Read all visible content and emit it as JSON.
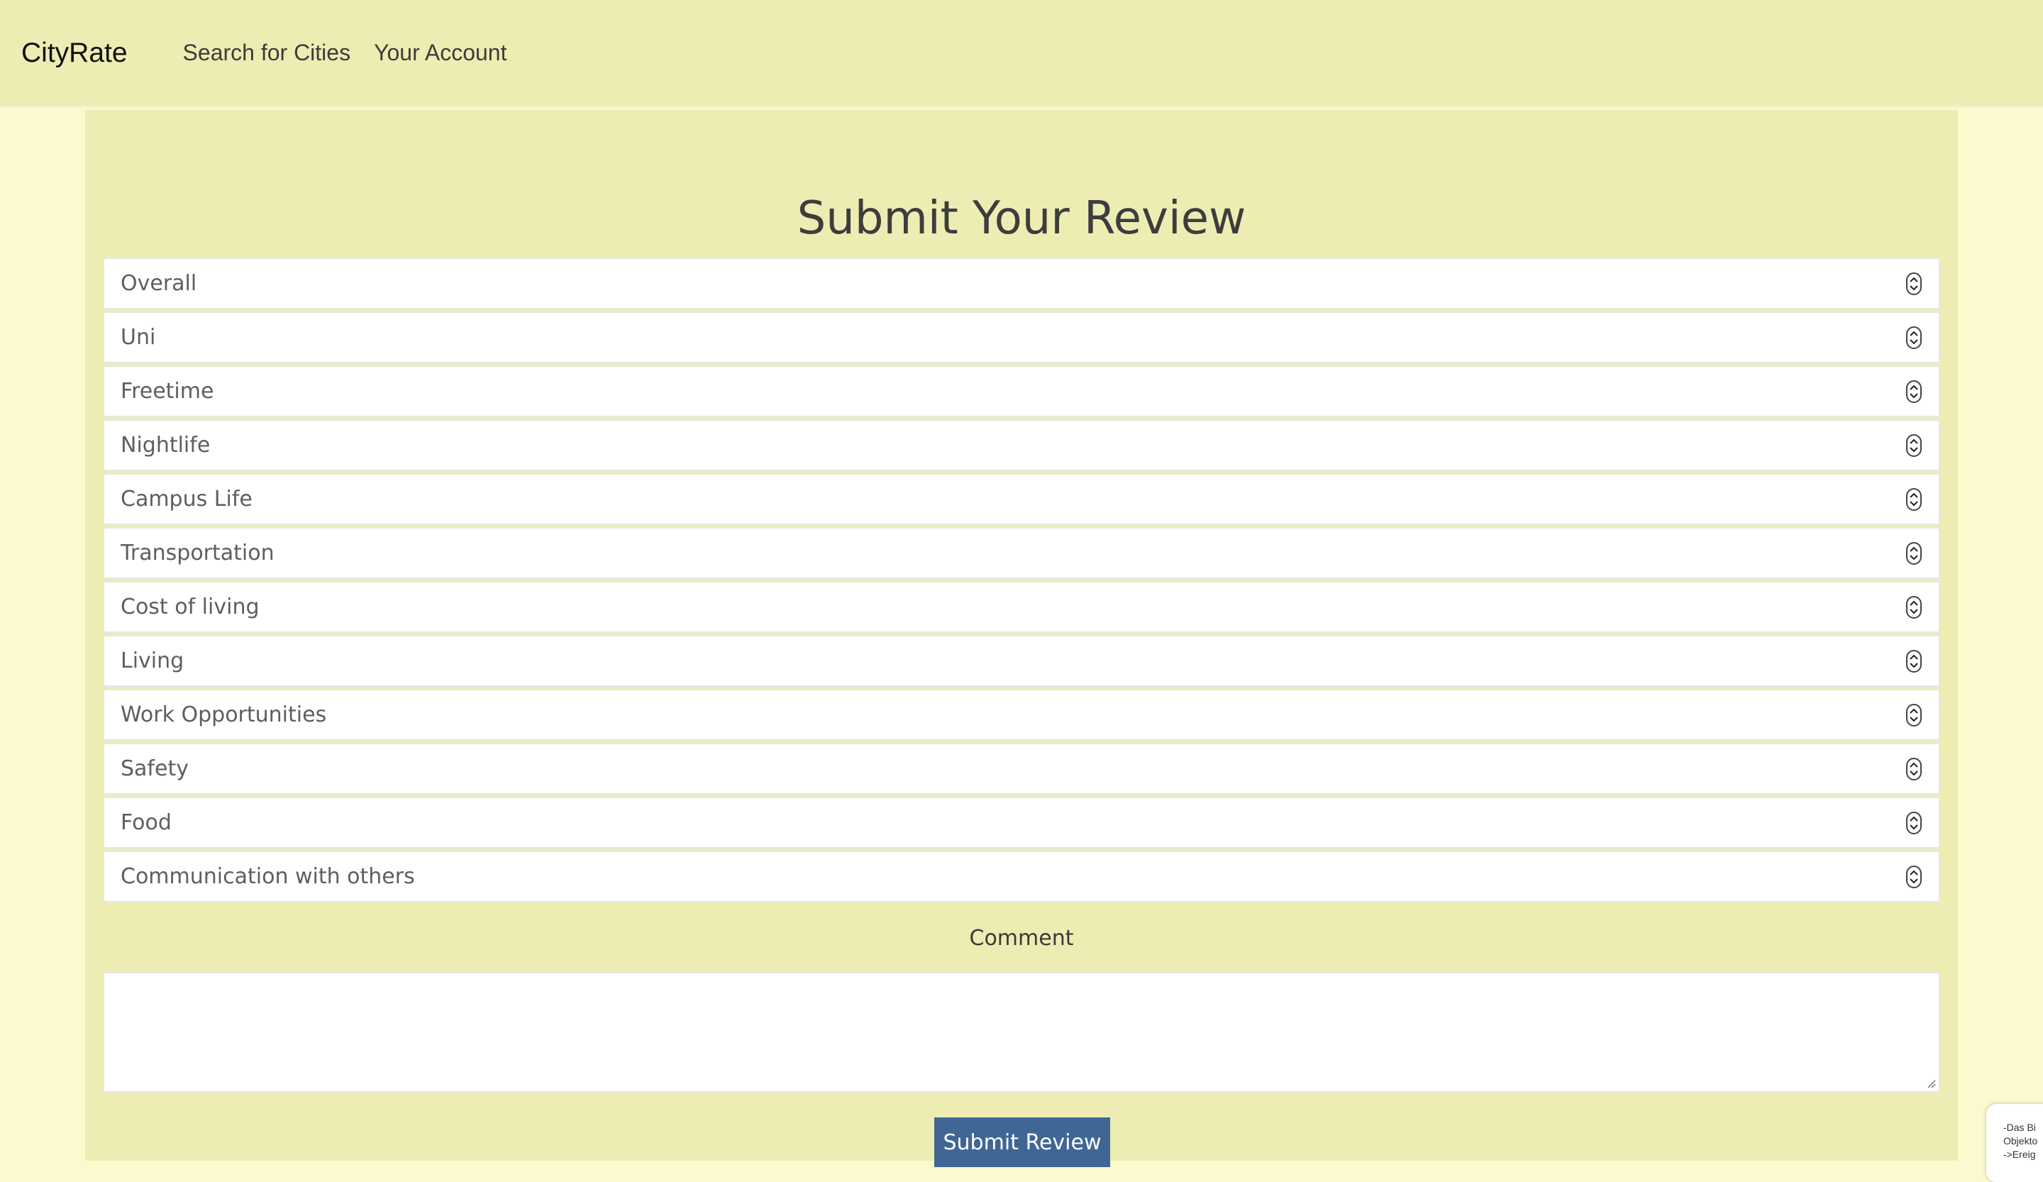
{
  "nav": {
    "brand": "CityRate",
    "links": [
      "Search for Cities",
      "Your Account"
    ]
  },
  "page": {
    "title": "Submit Your Review",
    "categories": [
      "Overall",
      "Uni",
      "Freetime",
      "Nightlife",
      "Campus Life",
      "Transportation",
      "Cost of living",
      "Living",
      "Work Opportunities",
      "Safety",
      "Food",
      "Communication with others"
    ],
    "comment_label": "Comment",
    "comment_value": "",
    "submit_label": "Submit Review"
  },
  "side_note": {
    "lines": [
      "-Das Bi",
      "Objekto",
      "->Ereig"
    ]
  },
  "colors": {
    "navbar": "#ededb3",
    "page_bg": "#fdf9cf",
    "button": "#3f6695"
  }
}
